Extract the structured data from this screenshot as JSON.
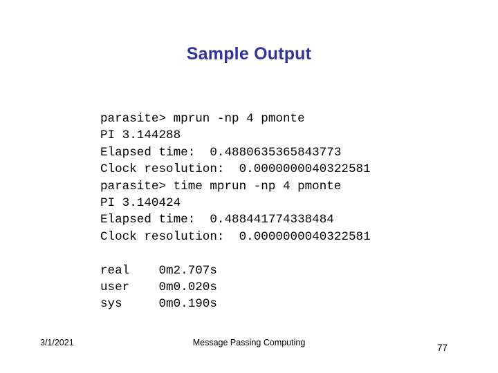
{
  "slide": {
    "title": "Sample Output",
    "title_color": "#33339c",
    "background_color": "#ffffff"
  },
  "terminal": {
    "block_1": "parasite> mprun -np 4 pmonte\nPI 3.144288\nElapsed time:  0.4880635365843773\nClock resolution:  0.0000000040322581\nparasite> time mprun -np 4 pmonte\nPI 3.140424\nElapsed time:  0.488441774338484\nClock resolution:  0.0000000040322581",
    "block_2": "real    0m2.707s\nuser    0m0.020s\nsys     0m0.190s",
    "lines": [
      "parasite> mprun -np 4 pmonte",
      "PI 3.144288",
      "Elapsed time:  0.4880635365843773",
      "Clock resolution:  0.0000000040322581",
      "parasite> time mprun -np 4 pmonte",
      "PI 3.140424",
      "Elapsed time:  0.488441774338484",
      "Clock resolution:  0.0000000040322581",
      "",
      "real    0m2.707s",
      "user    0m0.020s",
      "sys     0m0.190s"
    ]
  },
  "footer": {
    "date": "3/1/2021",
    "center_text": "Message Passing Computing",
    "page_number": "77"
  }
}
